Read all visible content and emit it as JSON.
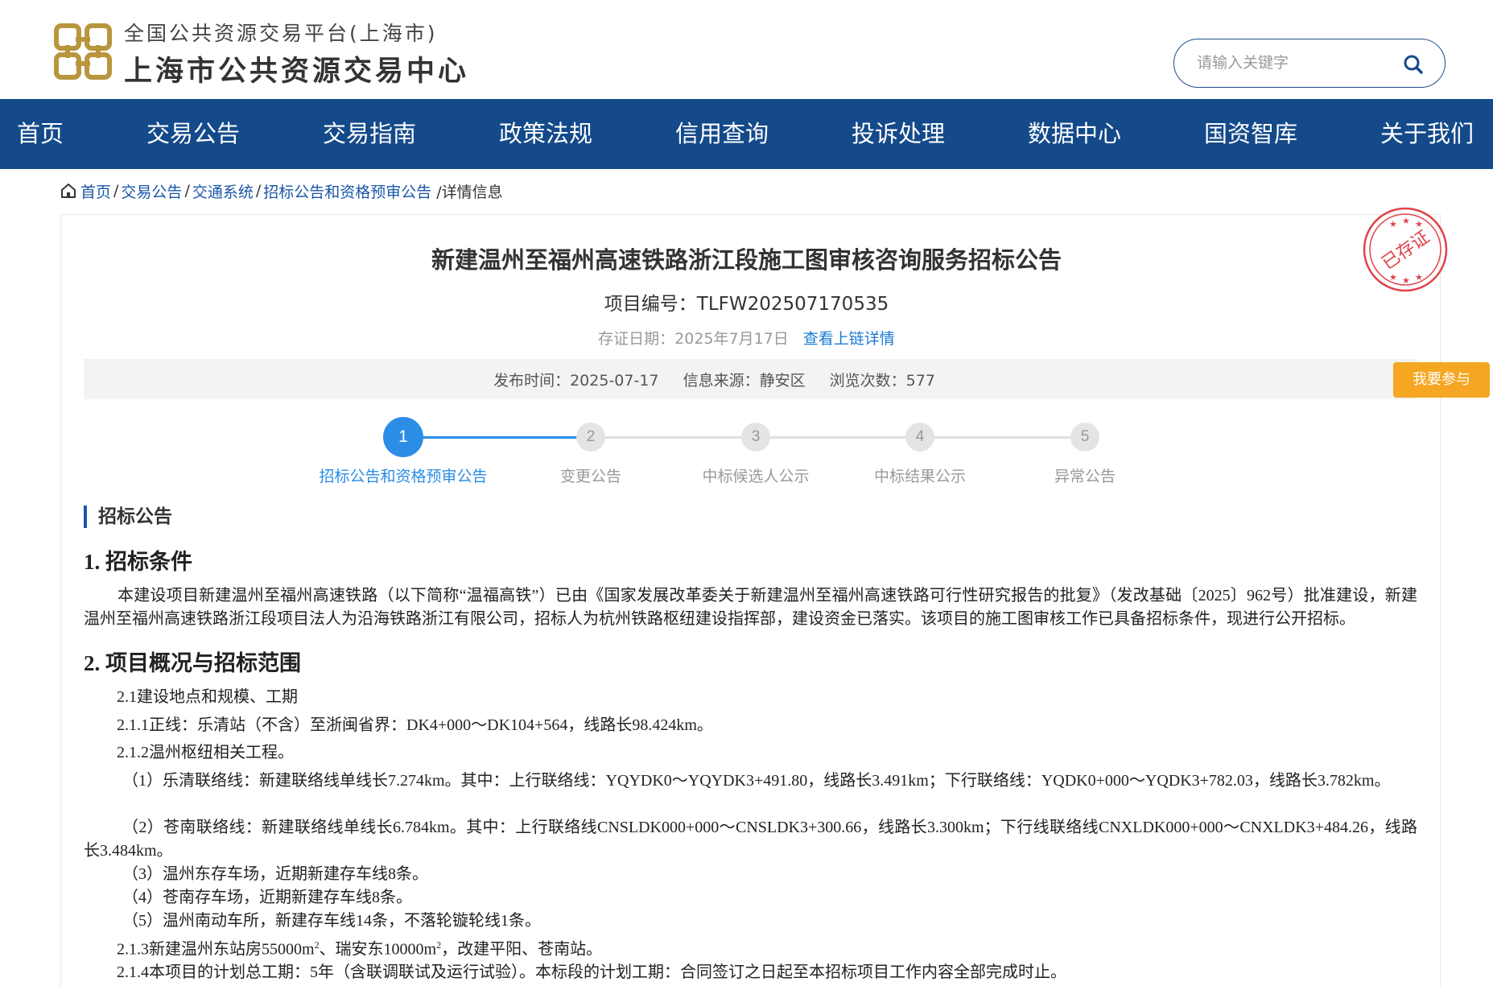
{
  "header": {
    "platform_sub": "全国公共资源交易平台(上海市)",
    "platform_main": "上海市公共资源交易中心",
    "search_placeholder": "请输入关键字"
  },
  "nav": [
    "首页",
    "交易公告",
    "交易指南",
    "政策法规",
    "信用查询",
    "投诉处理",
    "数据中心",
    "国资智库",
    "关于我们"
  ],
  "breadcrumb": {
    "items": [
      "首页",
      "交易公告",
      "交通系统",
      "招标公告和资格预审公告"
    ],
    "current": "/详情信息"
  },
  "notice": {
    "title": "新建温州至福州高速铁路浙江段施工图审核咨询服务招标公告",
    "project_no_label": "项目编号：",
    "project_no": "TLFW202507170535",
    "cert_date": "存证日期：2025年7月17日",
    "chain_link": "查看上链详情",
    "stamp_text": "已存证",
    "publish_time": "发布时间：2025-07-17",
    "source": "信息来源：静安区",
    "views": "浏览次数：577",
    "join_button": "我要参与"
  },
  "steps": [
    {
      "num": "1",
      "label": "招标公告和资格预审公告",
      "active": true
    },
    {
      "num": "2",
      "label": "变更公告",
      "active": false
    },
    {
      "num": "3",
      "label": "中标候选人公示",
      "active": false
    },
    {
      "num": "4",
      "label": "中标结果公示",
      "active": false
    },
    {
      "num": "5",
      "label": "异常公告",
      "active": false
    }
  ],
  "section_title": "招标公告",
  "content": {
    "h1": "1. 招标条件",
    "p1": "本建设项目新建温州至福州高速铁路（以下简称“温福高铁”）已由《国家发展改革委关于新建温州至福州高速铁路可行性研究报告的批复》（发改基础〔2025〕962号）批准建设，新建温州至福州高速铁路浙江段项目法人为沿海铁路浙江有限公司，招标人为杭州铁路枢纽建设指挥部，建设资金已落实。该项目的施工图审核工作已具备招标条件，现进行公开招标。",
    "h2": "2. 项目概况与招标范围",
    "l1": "2.1建设地点和规模、工期",
    "l2": "2.1.1正线：乐清站（不含）至浙闽省界：DK4+000～DK104+564，线路长98.424km。",
    "l3": "2.1.2温州枢纽相关工程。",
    "p2": "（1）乐清联络线：新建联络线单线长7.274km。其中：上行联络线：YQYDK0～YQYDK3+491.80，线路长3.491km；下行联络线：YQDK0+000～YQDK3+782.03，线路长3.782km。",
    "p3": "（2）苍南联络线：新建联络线单线长6.784km。其中：上行联络线CNSLDK000+000～CNSLDK3+300.66，线路长3.300km；下行线联络线CNXLDK000+000～CNXLDK3+484.26，线路长3.484km。",
    "l4": "（3）温州东存车场，近期新建存车线8条。",
    "l5": "（4）苍南存车场，近期新建存车线8条。",
    "l6": "（5）温州南动车所，新建存车线14条，不落轮镟轮线1条。",
    "l7a": "2.1.3新建温州东站房55000m",
    "l7b": "、瑞安东10000m",
    "l7c": "，改建平阳、苍南站。",
    "sup": "2",
    "l8": "2.1.4本项目的计划总工期：5年（含联调联试及运行试验）。本标段的计划工期：合同签订之日起至本招标项目工作内容全部完成时止。"
  },
  "colors": {
    "nav_bg": "#144a8a",
    "link": "#1a56a8",
    "step_active": "#2b8de6",
    "button": "#f5a623",
    "stamp": "#e0434a"
  }
}
